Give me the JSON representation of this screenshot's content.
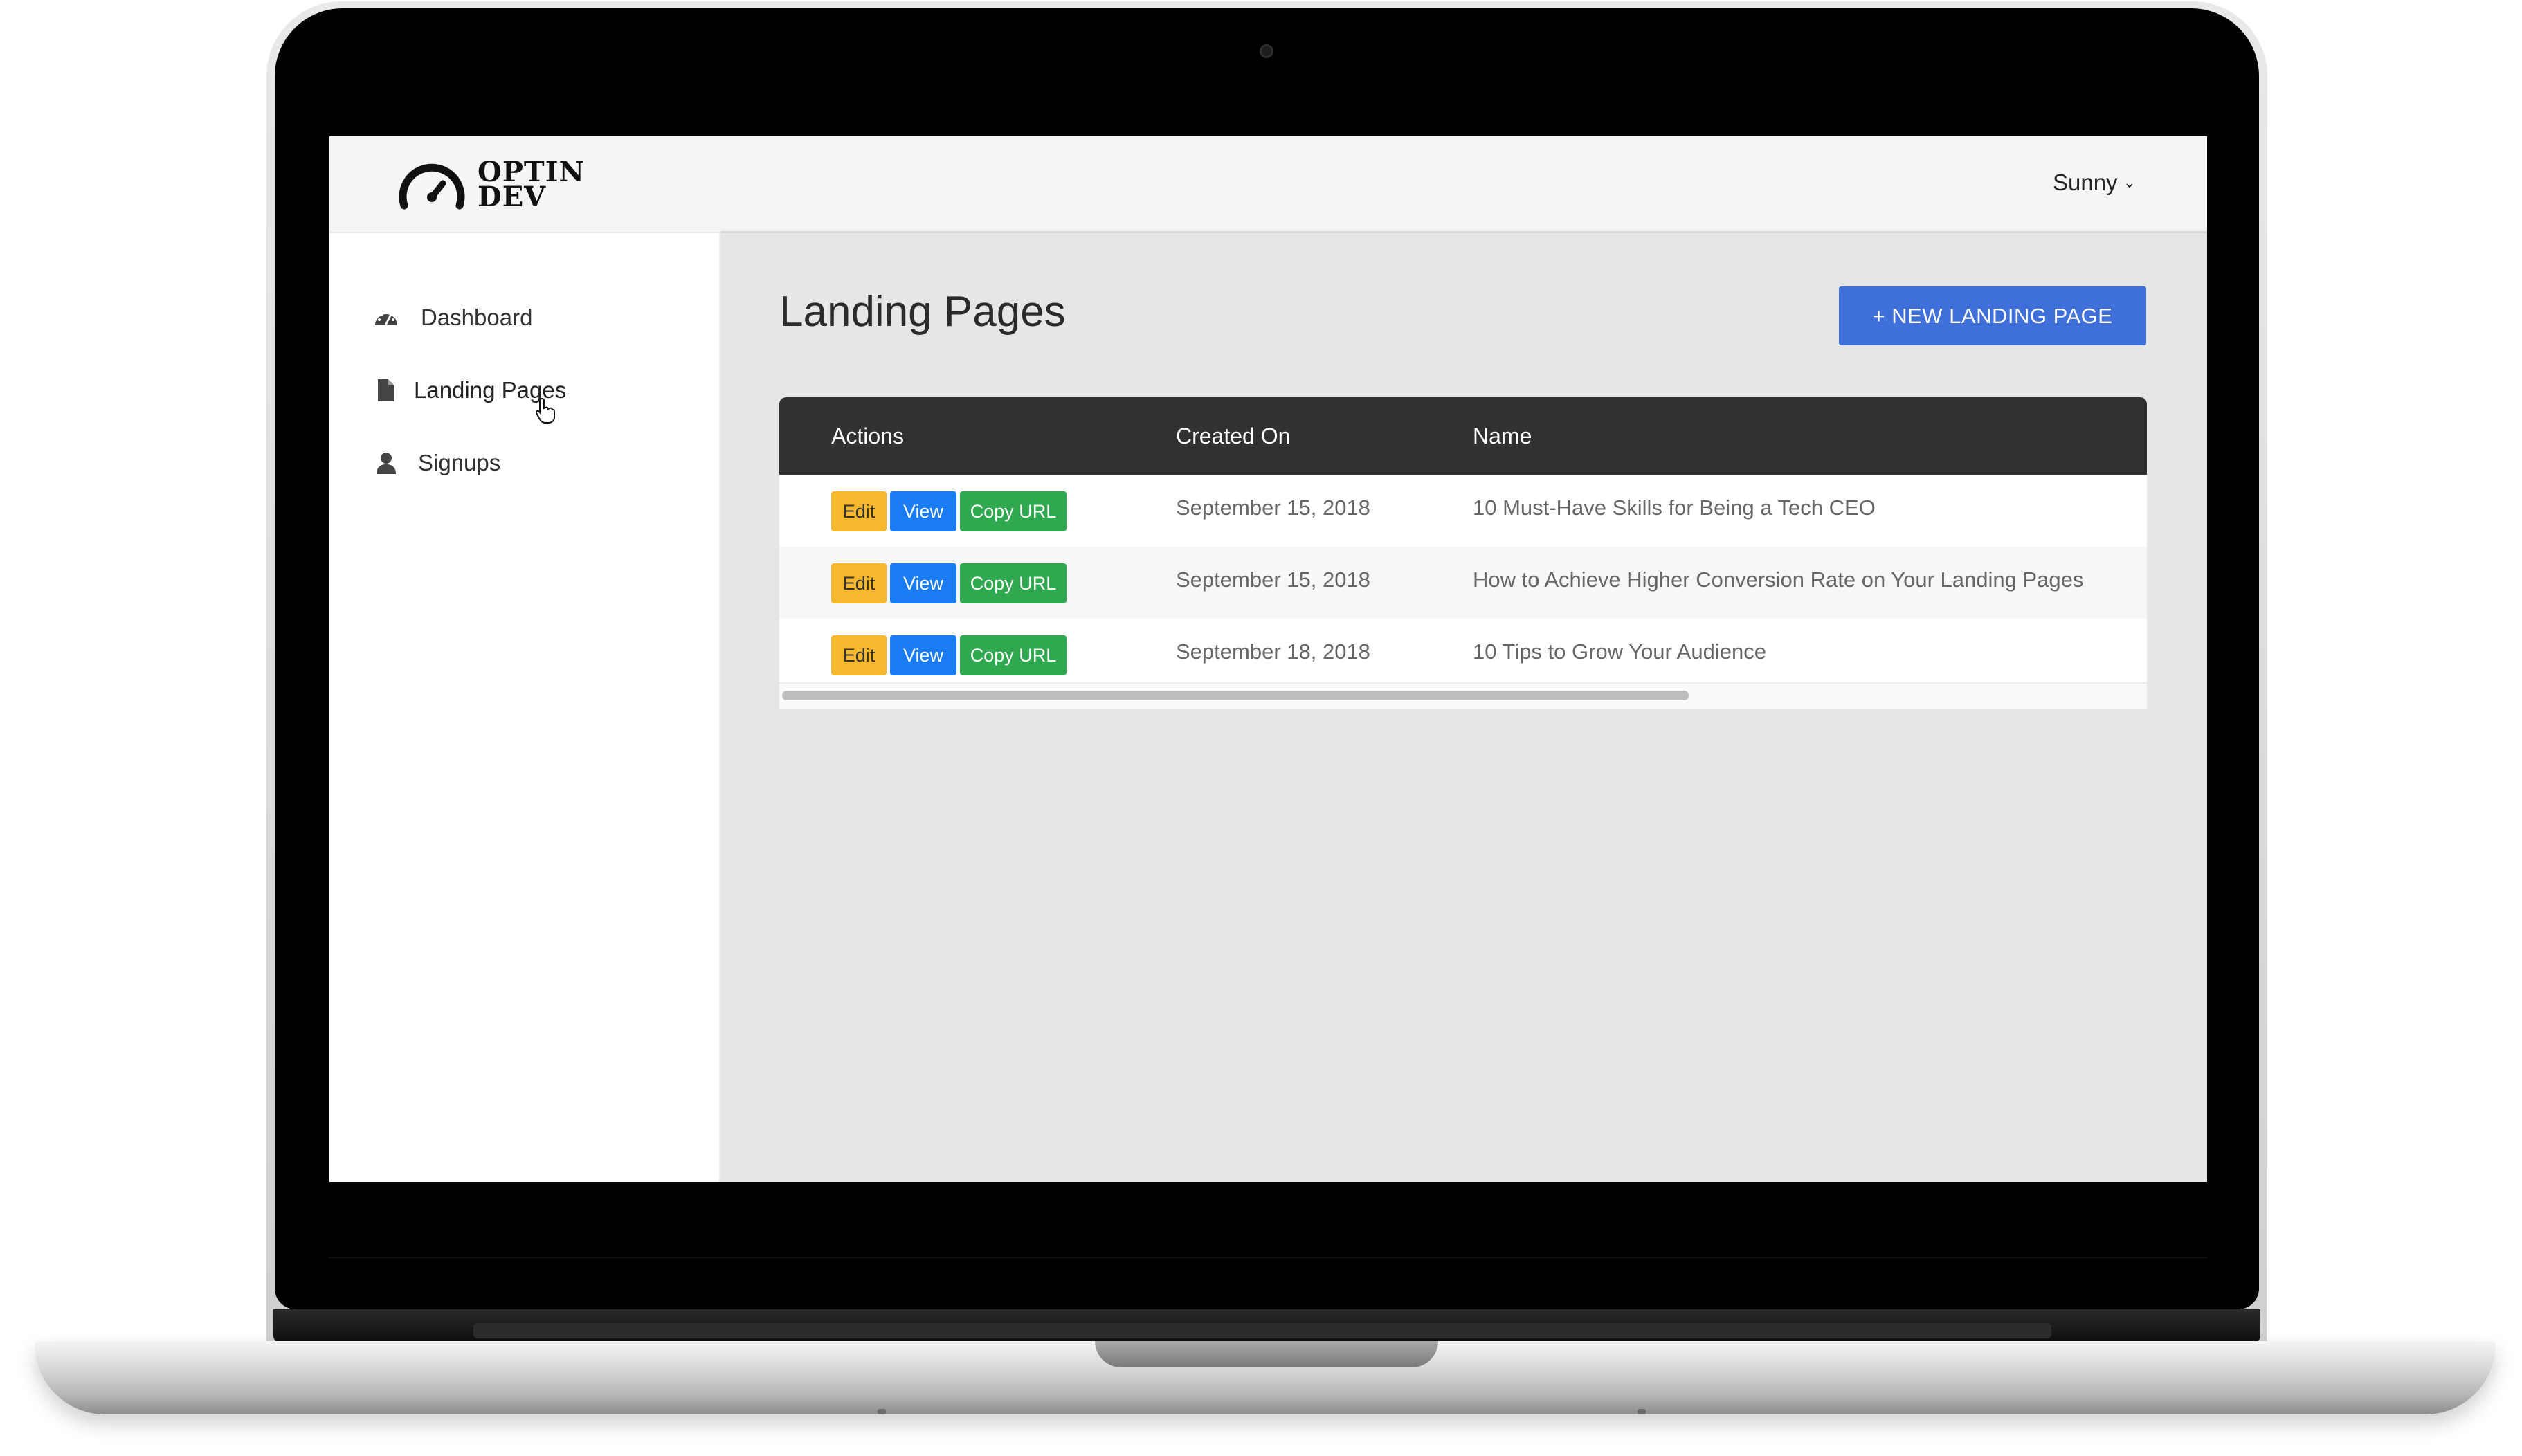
{
  "brand": {
    "logo_line1": "OPTIN",
    "logo_line2": "DEV"
  },
  "sidebar": {
    "items": [
      {
        "label": "Dashboard",
        "icon": "dashboard-gauge-icon"
      },
      {
        "label": "Landing Pages",
        "icon": "file-icon",
        "active": true
      },
      {
        "label": "Signups",
        "icon": "user-icon"
      }
    ]
  },
  "header": {
    "user_name": "Sunny",
    "user_menu_icon": "chevron-down-icon"
  },
  "main": {
    "title": "Landing Pages",
    "new_button_label": "+ NEW LANDING PAGE"
  },
  "table": {
    "columns": [
      "Actions",
      "Created On",
      "Name"
    ],
    "action_labels": {
      "edit": "Edit",
      "view": "View",
      "copy": "Copy URL"
    },
    "rows": [
      {
        "created_on": "September 15, 2018",
        "name": "10 Must-Have Skills for Being a Tech CEO"
      },
      {
        "created_on": "September 15, 2018",
        "name": "How to Achieve Higher Conversion Rate on Your Landing Pages"
      },
      {
        "created_on": "September 18, 2018",
        "name": "10 Tips to Grow Your Audience"
      }
    ]
  },
  "colors": {
    "primary_button": "#3f6fd8",
    "edit_button": "#f5b82e",
    "view_button": "#1a7cf2",
    "copy_button": "#2fa84f",
    "table_header": "#313131"
  }
}
